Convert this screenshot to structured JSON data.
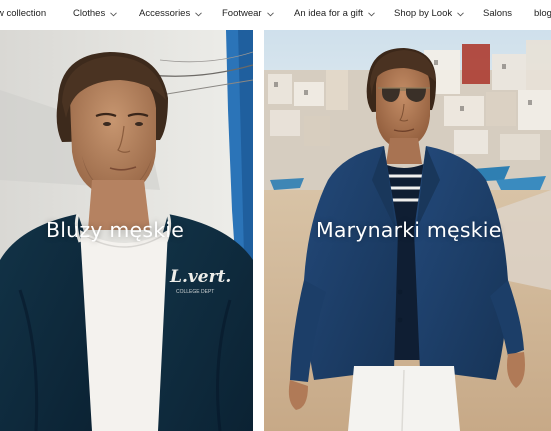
{
  "nav": {
    "items": [
      {
        "label": "w collection",
        "has_dropdown": false
      },
      {
        "label": "Clothes",
        "has_dropdown": true
      },
      {
        "label": "Accessories",
        "has_dropdown": true
      },
      {
        "label": "Footwear",
        "has_dropdown": true
      },
      {
        "label": "An idea for a gift",
        "has_dropdown": true
      },
      {
        "label": "Shop by Look",
        "has_dropdown": true
      },
      {
        "label": "Salons",
        "has_dropdown": false
      },
      {
        "label": "blog",
        "has_dropdown": false
      }
    ]
  },
  "tiles": [
    {
      "title": "Bluzy męskie",
      "jacket_print": "L.vert.",
      "jacket_print_sub": "COLLEGE DEPT"
    },
    {
      "title": "Marynarki męskie"
    }
  ],
  "colors": {
    "nav_text": "#1f1f1f",
    "tile_title": "#ffffff",
    "navy_jacket": "#0f2a3f",
    "blazer_blue": "#1d3f63",
    "wall_blue": "#2b74b8"
  },
  "icons": {
    "dropdown": "chevron-down-icon"
  }
}
